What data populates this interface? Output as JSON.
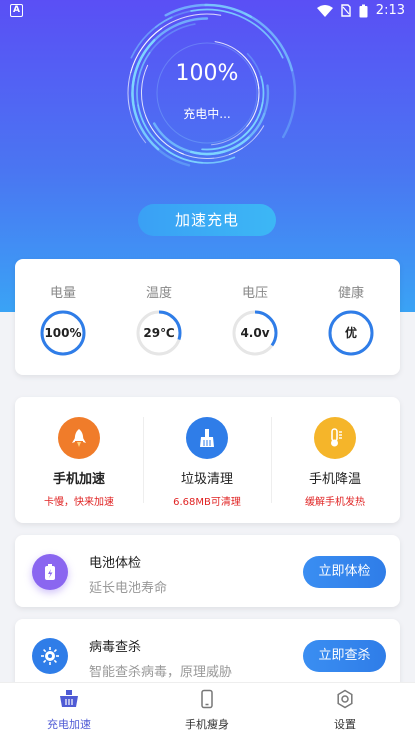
{
  "status_bar": {
    "time": "2:13"
  },
  "hero": {
    "percent": "100%",
    "status": "充电中...",
    "boost_button": "加速充电"
  },
  "stats": [
    {
      "label": "电量",
      "value": "100%",
      "level": 1.0
    },
    {
      "label": "温度",
      "value": "29℃",
      "level": 0.3
    },
    {
      "label": "电压",
      "value": "4.0v",
      "level": 0.35
    },
    {
      "label": "健康",
      "value": "优",
      "level": 1.0
    }
  ],
  "tools": [
    {
      "title": "手机加速",
      "subtitle": "卡慢，快来加速",
      "icon": "rocket-icon",
      "color": "#f07c2a"
    },
    {
      "title": "垃圾清理",
      "subtitle": "6.68MB可清理",
      "icon": "broom-icon",
      "color": "#2f7de8"
    },
    {
      "title": "手机降温",
      "subtitle": "缓解手机发热",
      "icon": "thermometer-icon",
      "color": "#f5b52a"
    }
  ],
  "rows": [
    {
      "title": "电池体检",
      "subtitle": "延长电池寿命",
      "button": "立即体检",
      "icon": "battery-icon",
      "color": "#8a66f0"
    },
    {
      "title": "病毒查杀",
      "subtitle": "智能查杀病毒，原理威胁",
      "button": "立即查杀",
      "icon": "virus-icon",
      "color": "#2f7de8"
    }
  ],
  "nav": [
    {
      "label": "充电加速",
      "icon": "basket-icon",
      "active": true
    },
    {
      "label": "手机瘦身",
      "icon": "phone-icon",
      "active": false
    },
    {
      "label": "设置",
      "icon": "gear-icon",
      "active": false
    }
  ],
  "colors": {
    "accent": "#2f7de8",
    "hero_top": "#5a4ff5",
    "hero_bottom": "#3aa3f5",
    "warn_text": "#e02424"
  }
}
